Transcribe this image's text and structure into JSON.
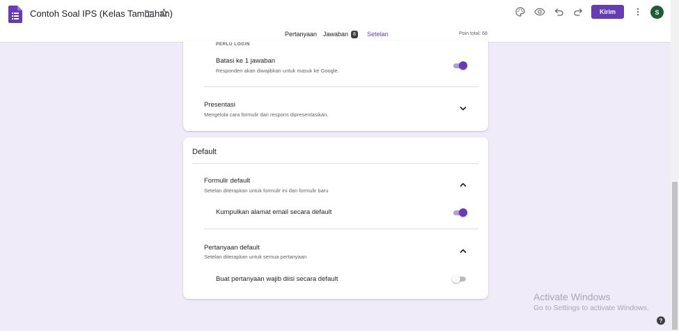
{
  "header": {
    "title": "Contoh Soal IPS (Kelas Tambahan)",
    "send_label": "Kirim",
    "avatar_initial": "S",
    "accent_color": "#673ab7",
    "icons": [
      "forms-icon",
      "folder-icon",
      "star-icon",
      "palette-icon",
      "preview-eye-icon",
      "undo-icon",
      "redo-icon",
      "more-vert-icon"
    ]
  },
  "tabs": {
    "questions": "Pertanyaan",
    "responses": "Jawaban",
    "responses_count": "8",
    "settings": "Setelan",
    "active": "Setelan",
    "points_total": "Poin total: 68"
  },
  "card1": {
    "section_label": "PERLU LOGIN",
    "limit": {
      "title": "Batasi ke 1 jawaban",
      "subtitle": "Responden akan diwajibkan untuk masuk ke Google.",
      "enabled": true
    },
    "presentation": {
      "title": "Presentasi",
      "subtitle": "Mengelola cara formulir dan respons dipresentasikan.",
      "expanded": false
    }
  },
  "card2": {
    "heading": "Default",
    "form_defaults": {
      "title": "Formulir default",
      "subtitle": "Setelan diterapkan untuk formulir ini dan formulir baru",
      "expanded": true,
      "collect_email": {
        "label": "Kumpulkan alamat email secara default",
        "enabled": true
      }
    },
    "question_defaults": {
      "title": "Pertanyaan default",
      "subtitle": "Setelan diterapkan untuk semua pertanyaan",
      "expanded": true,
      "required": {
        "label": "Buat pertanyaan wajib diisi secara default",
        "enabled": false
      }
    }
  },
  "watermark": {
    "title": "Activate Windows",
    "subtitle": "Go to Settings to activate Windows."
  },
  "help": "?"
}
